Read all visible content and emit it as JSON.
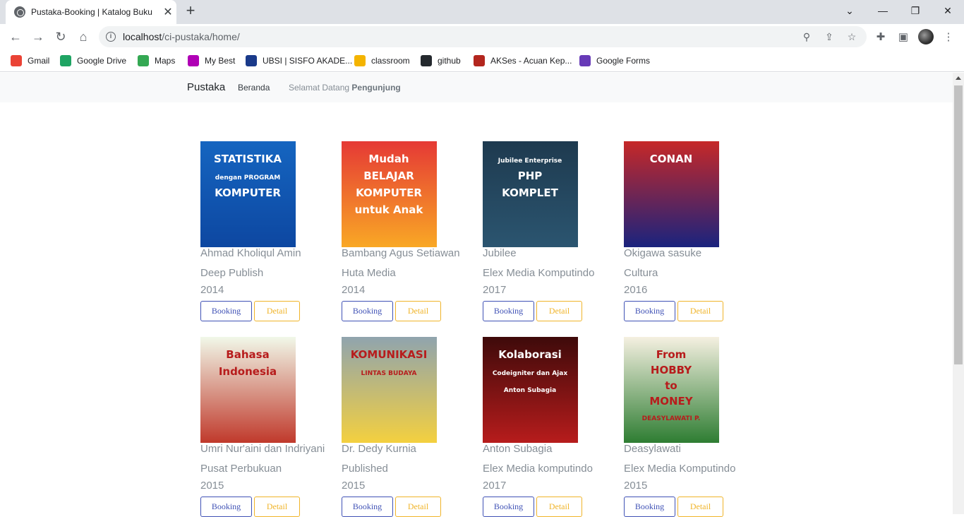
{
  "browser": {
    "tab_title": "Pustaka-Booking | Katalog Buku",
    "tab_close": "✕",
    "new_tab": "+",
    "url_host": "localhost",
    "url_path": "/ci-pustaka/home/",
    "window_controls": {
      "minimize": "—",
      "maximize": "❐",
      "close": "✕"
    },
    "nav": {
      "back": "←",
      "forward": "→",
      "reload": "↻",
      "home": "⌂"
    },
    "bookmarks": [
      {
        "label": "Gmail",
        "color": "#ea4335"
      },
      {
        "label": "Google Drive",
        "color": "#1fa463"
      },
      {
        "label": "Maps",
        "color": "#34a853"
      },
      {
        "label": "My Best",
        "color": "#b000b5"
      },
      {
        "label": "UBSI | SISFO AKADE...",
        "color": "#1a3a8a"
      },
      {
        "label": "classroom",
        "color": "#f4b400"
      },
      {
        "label": "github",
        "color": "#24292e"
      },
      {
        "label": "AKSes - Acuan Kep...",
        "color": "#b3261e"
      },
      {
        "label": "Google Forms",
        "color": "#673ab7"
      }
    ]
  },
  "navbar": {
    "brand": "Pustaka",
    "home": "Beranda",
    "welcome_prefix": "Selamat Datang",
    "welcome_user": "Pengunjung"
  },
  "books": [
    {
      "author": "Ahmad Kholiqul Amin",
      "publisher": "Deep Publish",
      "year": "2014",
      "booking": "Booking",
      "detail": "Detail",
      "cover_text": [
        "STATISTIKA",
        "dengan PROGRAM",
        "KOMPUTER"
      ],
      "cover_colors": [
        "#1565c0",
        "#0d47a1"
      ]
    },
    {
      "author": "Bambang Agus Setiawan",
      "publisher": "Huta Media",
      "year": "2014",
      "booking": "Booking",
      "detail": "Detail",
      "cover_text": [
        "Mudah",
        "BELAJAR",
        "KOMPUTER",
        "untuk Anak"
      ],
      "cover_colors": [
        "#e53935",
        "#f9a825"
      ]
    },
    {
      "author": "Jubilee",
      "publisher": "Elex Media Komputindo",
      "year": "2017",
      "booking": "Booking",
      "detail": "Detail",
      "cover_text": [
        "Jubilee Enterprise",
        "PHP",
        "KOMPLET"
      ],
      "cover_colors": [
        "#1e3a4f",
        "#2b5570"
      ]
    },
    {
      "author": "Okigawa sasuke",
      "publisher": "Cultura",
      "year": "2016",
      "booking": "Booking",
      "detail": "Detail",
      "cover_text": [
        "CONAN"
      ],
      "cover_colors": [
        "#c62828",
        "#1a237e"
      ]
    },
    {
      "author": "Umri Nur'aini dan Indriyani",
      "publisher": "Pusat Perbukuan",
      "year": "2015",
      "booking": "Booking",
      "detail": "Detail",
      "cover_text": [
        "Bahasa",
        "Indonesia"
      ],
      "cover_colors": [
        "#f1f8e9",
        "#c0392b"
      ]
    },
    {
      "author": "Dr. Dedy Kurnia",
      "publisher": "Published",
      "year": "2015",
      "booking": "Booking",
      "detail": "Detail",
      "cover_text": [
        "KOMUNIKASI",
        "LINTAS BUDAYA"
      ],
      "cover_colors": [
        "#90a4ae",
        "#f4d03f"
      ]
    },
    {
      "author": "Anton Subagia",
      "publisher": "Elex Media komputindo",
      "year": "2017",
      "booking": "Booking",
      "detail": "Detail",
      "cover_text": [
        "Kolaborasi",
        "Codeigniter dan Ajax",
        "Anton Subagia"
      ],
      "cover_colors": [
        "#3e0a0a",
        "#b71c1c"
      ]
    },
    {
      "author": "Deasylawati",
      "publisher": "Elex Media Komputindo",
      "year": "2015",
      "booking": "Booking",
      "detail": "Detail",
      "cover_text": [
        "From",
        "HOBBY",
        "to",
        "MONEY",
        "DEASYLAWATI P."
      ],
      "cover_colors": [
        "#f5f0e1",
        "#2e7d32"
      ]
    }
  ]
}
